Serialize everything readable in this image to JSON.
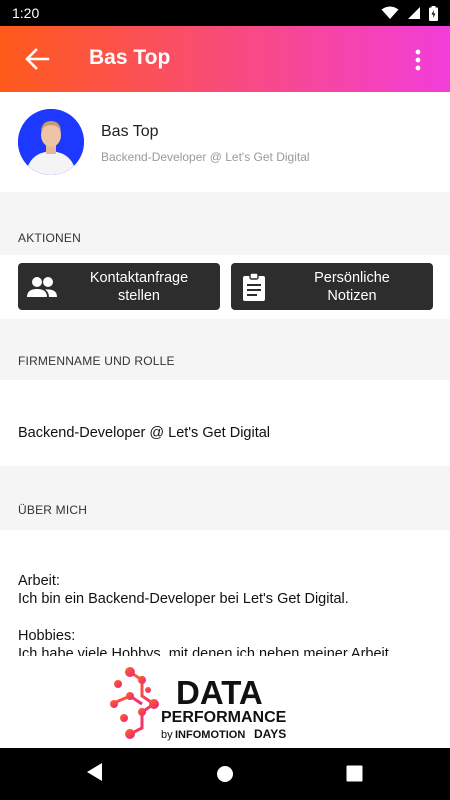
{
  "status_bar": {
    "time": "1:20"
  },
  "app_bar": {
    "title": "Bas Top",
    "gradient_start": "#ff5a1a",
    "gradient_end": "#f23dd9"
  },
  "profile": {
    "name": "Bas Top",
    "role": "Backend-Developer @ Let's Get Digital",
    "avatar_bg": "#1d39ff"
  },
  "actions": {
    "section_title": "AKTIONEN",
    "contact_request": {
      "line1": "Kontaktanfrage",
      "line2": "stellen"
    },
    "notes": {
      "line1": "Persönliche",
      "line2": "Notizen"
    }
  },
  "company": {
    "section_title": "FIRMENNAME UND ROLLE",
    "value": "Backend-Developer @ Let's Get Digital"
  },
  "about": {
    "section_title": "ÜBER MICH",
    "work_label": "Arbeit:",
    "work_text": "Ich bin ein Backend-Developer bei Let's Get Digital.",
    "hobbies_label": "Hobbies:",
    "hobbies_text": "Ich habe viele Hobbys, mit denen ich neben meiner Arbeit"
  },
  "logo": {
    "line1": "DATA",
    "line2": "PERFORMANCE",
    "line3_prefix": "by",
    "line3_brand": "INFOMOTION",
    "line3_suffix": "DAYS"
  },
  "icons": {
    "back": "arrow-left-icon",
    "more": "more-vertical-icon",
    "wifi": "wifi-icon",
    "signal": "signal-icon",
    "battery": "battery-icon",
    "people": "people-icon",
    "clipboard": "clipboard-icon",
    "nav_back": "nav-back-icon",
    "nav_home": "nav-home-icon",
    "nav_recents": "nav-recents-icon"
  }
}
